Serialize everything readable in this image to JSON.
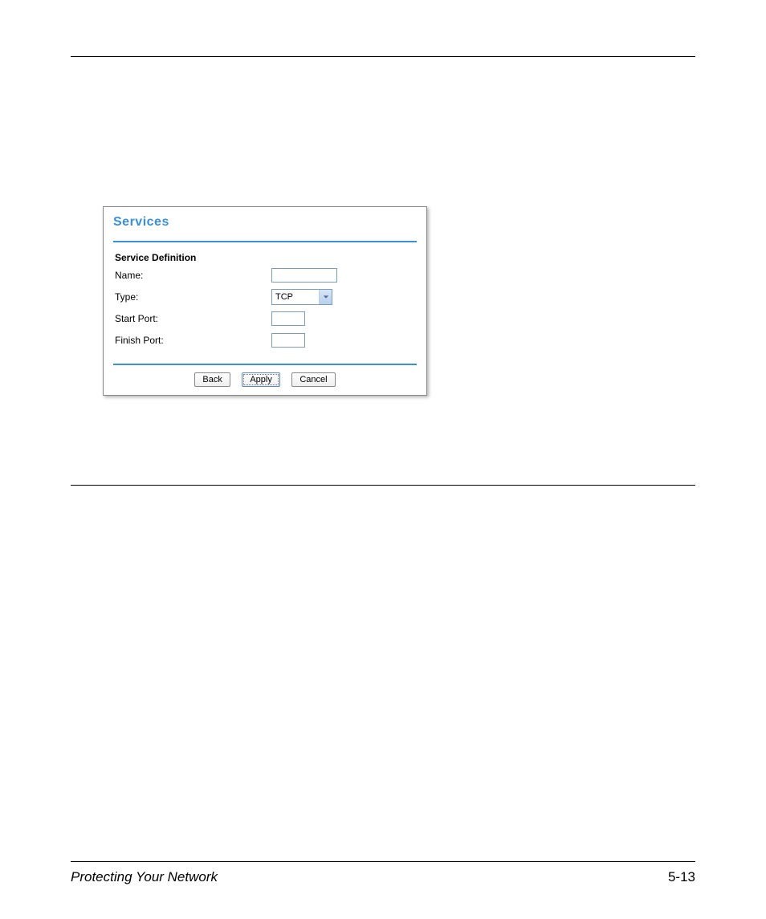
{
  "footer": {
    "left": "Protecting Your Network",
    "right": "5-13"
  },
  "panel": {
    "title": "Services",
    "section_title": "Service Definition",
    "fields": {
      "name_label": "Name:",
      "name_value": "",
      "type_label": "Type:",
      "type_value": "TCP",
      "start_port_label": "Start Port:",
      "start_port_value": "",
      "finish_port_label": "Finish Port:",
      "finish_port_value": ""
    },
    "buttons": {
      "back": "Back",
      "apply": "Apply",
      "cancel": "Cancel"
    }
  }
}
